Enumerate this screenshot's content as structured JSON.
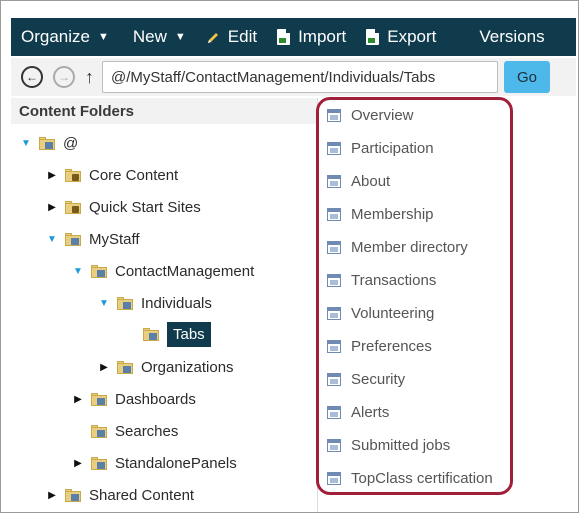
{
  "toolbar": {
    "organize_label": "Organize",
    "new_label": "New",
    "edit_label": "Edit",
    "import_label": "Import",
    "export_label": "Export",
    "versions_label": "Versions",
    "versions_colors": [
      "#e6c23a",
      "#e24f4f",
      "#3fa34d",
      "#3b82d6"
    ]
  },
  "address": {
    "path_value": "@/MyStaff/ContactManagement/Individuals/Tabs",
    "go_label": "Go"
  },
  "left_panel": {
    "title": "Content Folders",
    "tree": {
      "root": "@",
      "core_content": "Core Content",
      "quick_start": "Quick Start Sites",
      "mystaff": "MyStaff",
      "contact_mgmt": "ContactManagement",
      "individuals": "Individuals",
      "tabs": "Tabs",
      "organizations": "Organizations",
      "dashboards": "Dashboards",
      "searches": "Searches",
      "standalone": "StandalonePanels",
      "shared": "Shared Content"
    }
  },
  "right_panel": {
    "items": [
      "Overview",
      "Participation",
      "About",
      "Membership",
      "Member directory",
      "Transactions",
      "Volunteering",
      "Preferences",
      "Security",
      "Alerts",
      "Submitted jobs",
      "TopClass certification"
    ]
  },
  "colors": {
    "toolbar_bg": "#0f3b4c",
    "go_button": "#4db8ea",
    "highlight": "#a0203a",
    "selected_bg": "#0f3b4c"
  }
}
